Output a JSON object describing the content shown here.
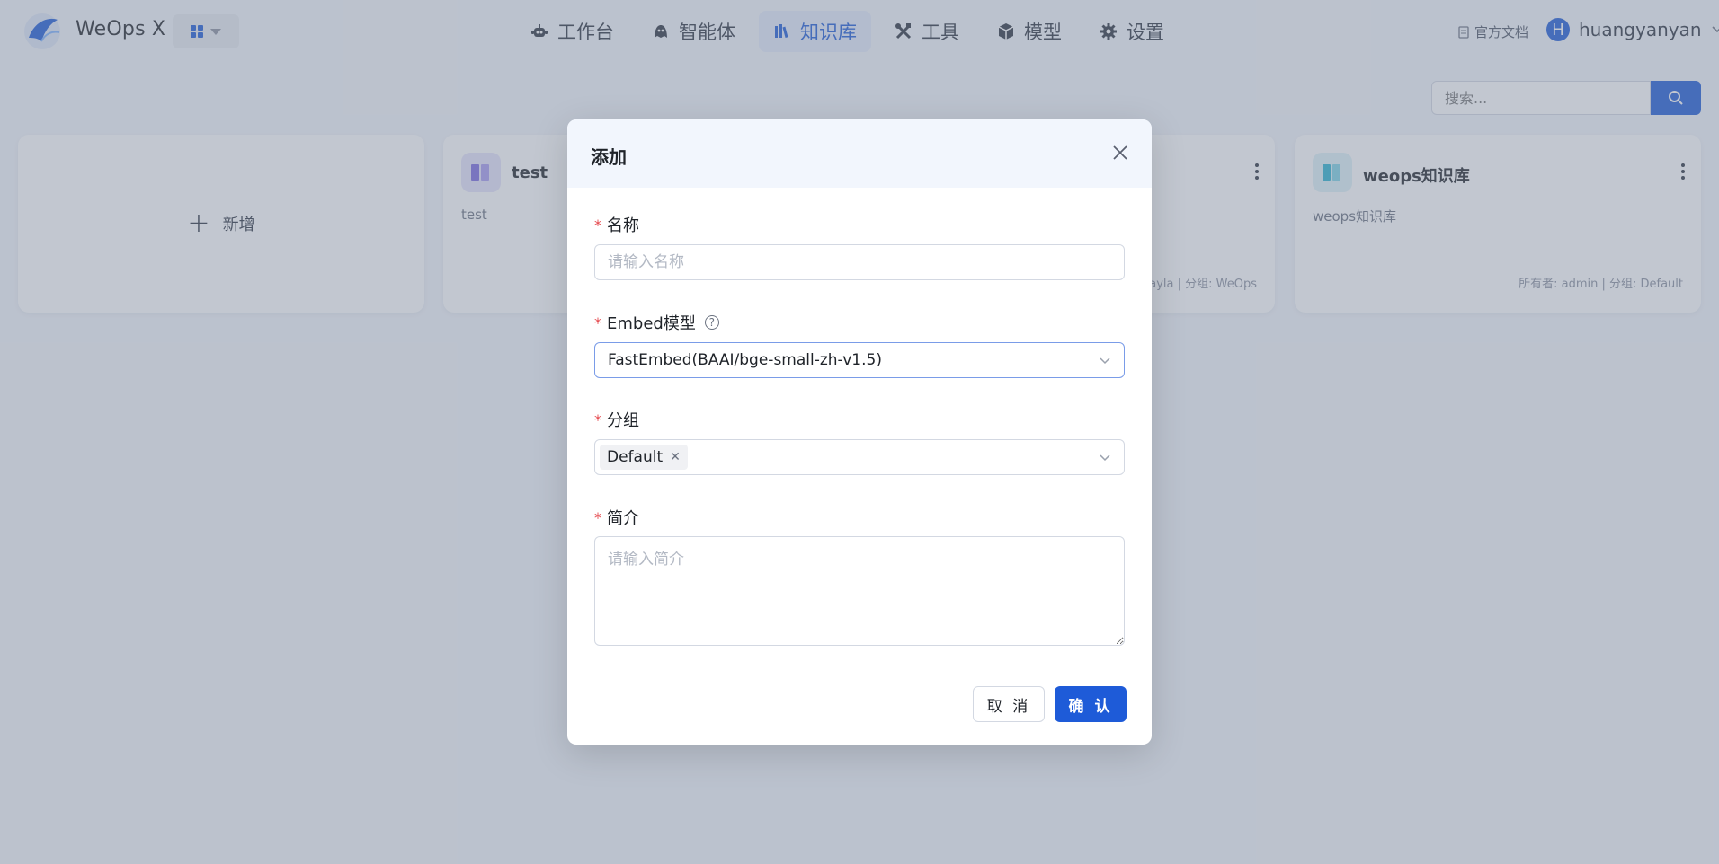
{
  "header": {
    "app_title": "WeOps X",
    "nav": [
      {
        "label": "工作台",
        "icon": "robot-icon",
        "active": false
      },
      {
        "label": "智能体",
        "icon": "agent-icon",
        "active": false
      },
      {
        "label": "知识库",
        "icon": "books-icon",
        "active": true
      },
      {
        "label": "工具",
        "icon": "tools-icon",
        "active": false
      },
      {
        "label": "模型",
        "icon": "cube-icon",
        "active": false
      },
      {
        "label": "设置",
        "icon": "gear-icon",
        "active": false
      }
    ],
    "doc_link": "官方文档",
    "user": {
      "initial": "H",
      "name": "huangyanyan"
    }
  },
  "search": {
    "placeholder": "搜索..."
  },
  "cards": {
    "add_label": "新增",
    "items": [
      {
        "name": "test",
        "description": "test",
        "meta": ""
      },
      {
        "name": "",
        "description": "",
        "meta": "ayla  |  分组: WeOps"
      },
      {
        "name": "weops知识库",
        "description": "weops知识库",
        "meta": "所有者: admin  |  分组: Default"
      }
    ]
  },
  "modal": {
    "title": "添加",
    "name_label": "名称",
    "name_placeholder": "请输入名称",
    "embed_label": "Embed模型",
    "embed_value": "FastEmbed(BAAI/bge-small-zh-v1.5)",
    "group_label": "分组",
    "group_tags": [
      "Default"
    ],
    "intro_label": "简介",
    "intro_placeholder": "请输入简介",
    "cancel_label": "取 消",
    "ok_label": "确 认"
  },
  "colors": {
    "accent": "#1e5bd8",
    "required": "#e5484d"
  }
}
